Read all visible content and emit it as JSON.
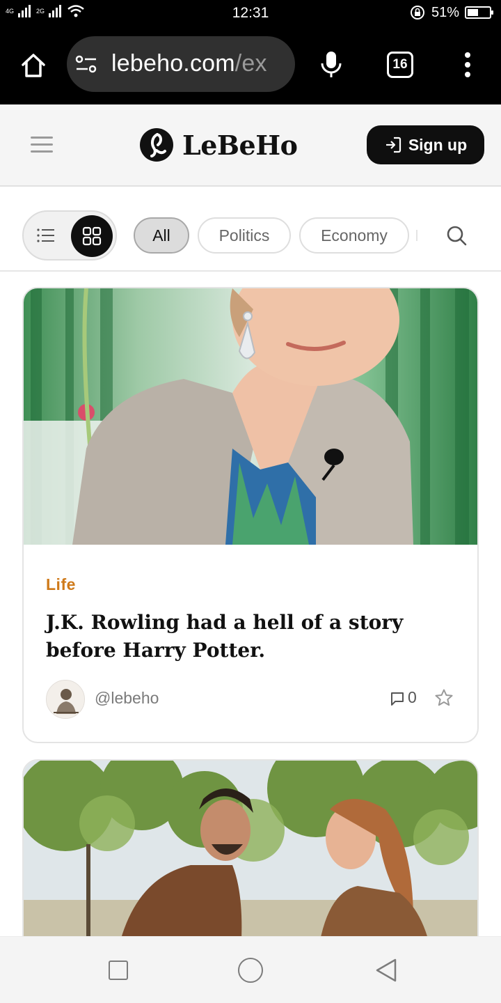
{
  "status_bar": {
    "network_label_1": "4G",
    "network_label_2": "2G",
    "time": "12:31",
    "battery_percent_text": "51%",
    "battery_level": 0.51
  },
  "browser": {
    "url_host": "lebeho.com",
    "url_rest": "/ex",
    "tab_count": "16",
    "icons": {
      "home": "home-icon",
      "site_settings": "tune-icon",
      "mic": "mic-icon",
      "menu": "more-vert-icon"
    }
  },
  "header": {
    "brand": "LeBeHo",
    "signup_label": "Sign up",
    "icons": {
      "menu": "hamburger-icon",
      "signup": "login-icon"
    }
  },
  "filters": {
    "categories": [
      {
        "label": "All",
        "active": true
      },
      {
        "label": "Politics",
        "active": false
      },
      {
        "label": "Economy",
        "active": false
      }
    ],
    "view_mode": "grid",
    "icons": {
      "list": "list-icon",
      "grid": "grid-icon",
      "search": "search-icon"
    }
  },
  "articles": [
    {
      "category": "Life",
      "title": "J.K. Rowling had a hell of a story before Harry Potter.",
      "author": "@lebeho",
      "comments": "0"
    },
    {
      "category": "",
      "title": "",
      "author": "",
      "comments": ""
    }
  ],
  "colors": {
    "accent_category": "#cf7a1a",
    "button_dark": "#0f0f0f",
    "header_bg": "#f5f5f5"
  }
}
